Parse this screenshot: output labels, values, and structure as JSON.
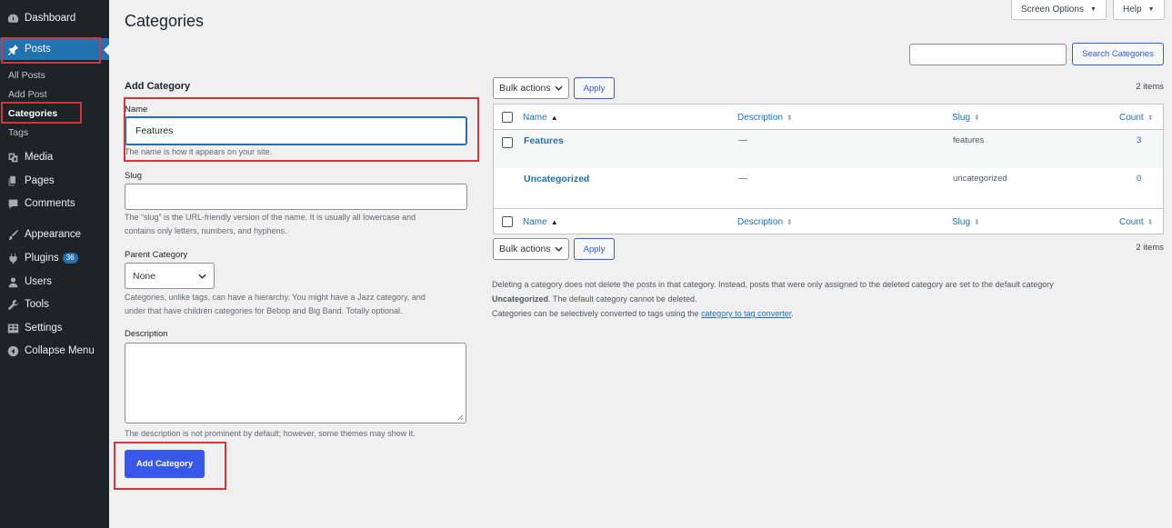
{
  "sidebar": {
    "items": [
      {
        "label": "Dashboard",
        "icon": "dashboard-icon"
      },
      {
        "label": "Posts",
        "icon": "pin-icon"
      },
      {
        "label": "Media",
        "icon": "media-icon"
      },
      {
        "label": "Pages",
        "icon": "pages-icon"
      },
      {
        "label": "Comments",
        "icon": "comments-icon"
      },
      {
        "label": "Appearance",
        "icon": "brush-icon"
      },
      {
        "label": "Plugins",
        "icon": "plugin-icon",
        "badge": "36"
      },
      {
        "label": "Users",
        "icon": "user-icon"
      },
      {
        "label": "Tools",
        "icon": "wrench-icon"
      },
      {
        "label": "Settings",
        "icon": "settings-icon"
      },
      {
        "label": "Collapse Menu",
        "icon": "collapse-icon"
      }
    ],
    "submenu": [
      "All Posts",
      "Add Post",
      "Categories",
      "Tags"
    ]
  },
  "header": {
    "title": "Categories",
    "screen_options": "Screen Options",
    "help": "Help"
  },
  "form": {
    "title": "Add Category",
    "name_label": "Name",
    "name_value": "Features",
    "name_help": "The name is how it appears on your site.",
    "slug_label": "Slug",
    "slug_help_1": "The “slug” is the URL-friendly version of the name. It is usually all lowercase and",
    "slug_help_2": "contains only letters, numbers, and hyphens.",
    "parent_label": "Parent Category",
    "parent_value": "None",
    "parent_help_1": "Categories, unlike tags, can have a hierarchy. You might have a Jazz category, and",
    "parent_help_2": "under that have children categories for Bebop and Big Band. Totally optional.",
    "description_label": "Description",
    "description_help": "The description is not prominent by default; however, some themes may show it.",
    "submit": "Add Category"
  },
  "list": {
    "search_button": "Search Categories",
    "bulk_actions": "Bulk actions",
    "apply": "Apply",
    "items_count": "2 items",
    "columns": {
      "name": "Name",
      "description": "Description",
      "slug": "Slug",
      "count": "Count"
    },
    "rows": [
      {
        "name": "Features",
        "description": "—",
        "slug": "features",
        "count": "3"
      },
      {
        "name": "Uncategorized",
        "description": "—",
        "slug": "uncategorized",
        "count": "0"
      }
    ],
    "note_1": "Deleting a category does not delete the posts in that category. Instead, posts that were only assigned to the deleted category are set to the default category",
    "note_2_bold": "Uncategorized",
    "note_2_rest": ". The default category cannot be deleted.",
    "note_3_pre": "Categories can be selectively converted to tags using the ",
    "note_3_link": "category to tag converter",
    "note_3_post": "."
  },
  "colors": {
    "sidebar_bg": "#1d2327",
    "accent": "#3858e9",
    "highlight": "#d63638",
    "page_bg": "#f0f0f1"
  }
}
